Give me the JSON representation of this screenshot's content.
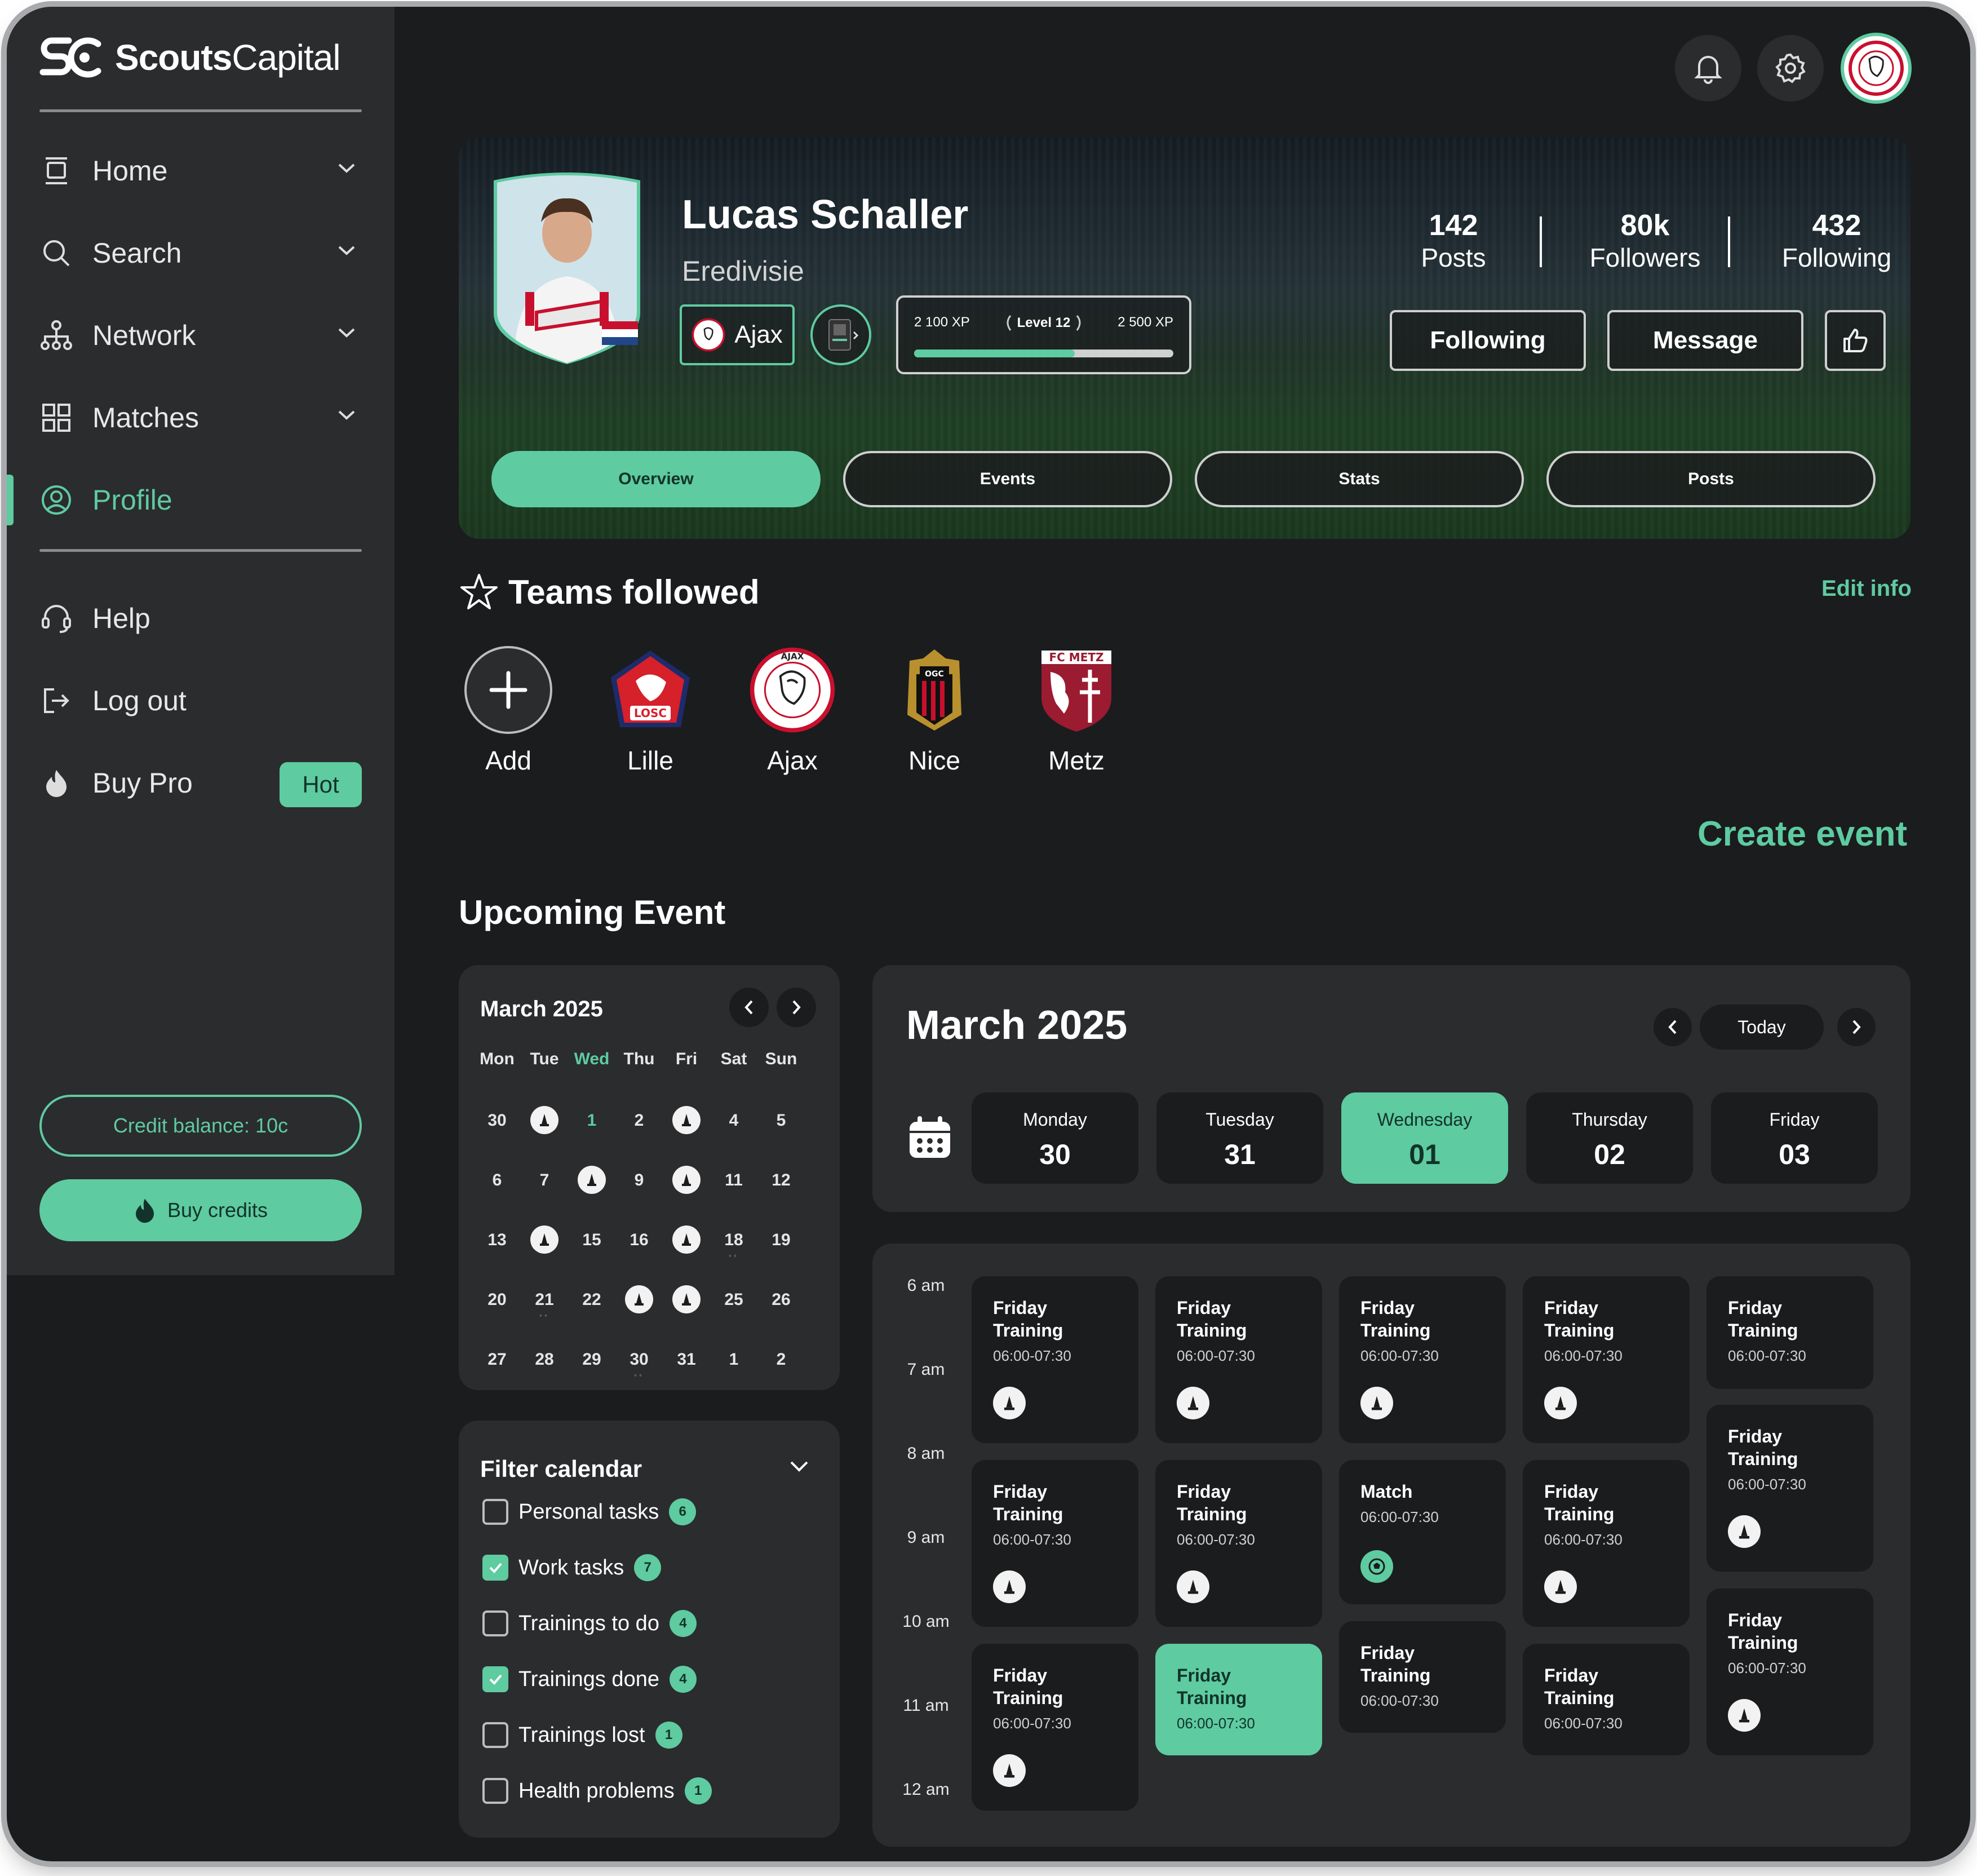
{
  "app": {
    "brand_bold": "Scouts",
    "brand_light": "Capital",
    "accent": "#5ecba1",
    "background": "#1b1c1e",
    "panel": "#2b2c2e"
  },
  "sidebar": {
    "items": [
      {
        "label": "Home",
        "icon": "home-icon"
      },
      {
        "label": "Search",
        "icon": "search-icon"
      },
      {
        "label": "Network",
        "icon": "network-icon"
      },
      {
        "label": "Matches",
        "icon": "grid-icon"
      },
      {
        "label": "Profile",
        "icon": "user-circle-icon",
        "active": true
      }
    ],
    "bottom_items": [
      {
        "label": "Help",
        "icon": "headset-icon"
      },
      {
        "label": "Log out",
        "icon": "logout-icon"
      },
      {
        "label": "Buy Pro",
        "icon": "fire-icon",
        "badge": "Hot"
      }
    ],
    "credit_balance": "Credit balance: 10c",
    "buy_credits": "Buy credits"
  },
  "profile": {
    "name": "Lucas Schaller",
    "league": "Eredivisie",
    "club": "Ajax",
    "xp_current": "2 100 XP",
    "level": "Level 12",
    "xp_next": "2 500 XP",
    "xp_progress": 0.62,
    "stats": [
      {
        "num": "142",
        "label": "Posts"
      },
      {
        "num": "80k",
        "label": "Followers"
      },
      {
        "num": "432",
        "label": "Following"
      }
    ],
    "following_btn": "Following",
    "message_btn": "Message",
    "tabs": [
      "Overview",
      "Events",
      "Stats",
      "Posts"
    ]
  },
  "teams": {
    "title": "Teams followed",
    "edit": "Edit info",
    "add": "Add",
    "list": [
      {
        "name": "Lille",
        "color": "#d6202a"
      },
      {
        "name": "Ajax",
        "color": "#c8102e"
      },
      {
        "name": "Nice",
        "color": "#c8102e"
      },
      {
        "name": "Metz",
        "color": "#9b1b30"
      }
    ]
  },
  "create_event": "Create event",
  "upcoming_title": "Upcoming Event",
  "mini_calendar": {
    "title": "March 2025",
    "dow": [
      "Mon",
      "Tue",
      "Wed",
      "Thu",
      "Fri",
      "Sat",
      "Sun"
    ],
    "weeks": [
      [
        "30",
        "@",
        "1",
        "2",
        "@",
        "4",
        "5"
      ],
      [
        "6",
        "7",
        "@",
        "9",
        "@",
        "11",
        "12"
      ],
      [
        "13",
        "@",
        "15",
        "16",
        "@",
        "18",
        "19"
      ],
      [
        "20",
        "21",
        "22",
        "@",
        "@",
        "25",
        "26"
      ],
      [
        "27",
        "28",
        "29",
        "30",
        "31",
        "1",
        "2"
      ]
    ]
  },
  "filter": {
    "title": "Filter calendar",
    "items": [
      {
        "label": "Personal tasks",
        "count": "6",
        "checked": false
      },
      {
        "label": "Work tasks",
        "count": "7",
        "checked": true
      },
      {
        "label": "Trainings to do",
        "count": "4",
        "checked": false
      },
      {
        "label": "Trainings done",
        "count": "4",
        "checked": true
      },
      {
        "label": "Trainings lost",
        "count": "1",
        "checked": false
      },
      {
        "label": "Health problems",
        "count": "1",
        "checked": false
      }
    ]
  },
  "week": {
    "title": "March 2025",
    "today": "Today",
    "days": [
      {
        "name": "Monday",
        "num": "30"
      },
      {
        "name": "Tuesday",
        "num": "31"
      },
      {
        "name": "Wednesday",
        "num": "01",
        "active": true
      },
      {
        "name": "Thursday",
        "num": "02"
      },
      {
        "name": "Friday",
        "num": "03"
      }
    ]
  },
  "schedule": {
    "hours": [
      "6 am",
      "7 am",
      "8 am",
      "9 am",
      "10 am",
      "11 am",
      "12 am"
    ],
    "training_title": "Friday\nTraining",
    "match_title": "Match",
    "time": "06:00-07:30"
  }
}
